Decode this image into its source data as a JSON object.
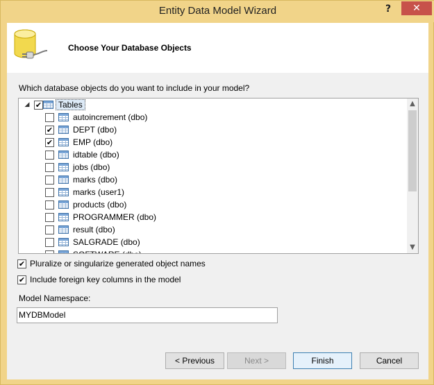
{
  "window": {
    "title": "Entity Data Model Wizard",
    "help_label": "?",
    "close_label": "✕"
  },
  "header": {
    "title": "Choose Your Database Objects"
  },
  "prompt": "Which database objects do you want to include in your model?",
  "tree": {
    "root": {
      "label": "Tables",
      "checked": true,
      "expanded": true
    },
    "items": [
      {
        "label": "autoincrement (dbo)",
        "checked": false
      },
      {
        "label": "DEPT (dbo)",
        "checked": true
      },
      {
        "label": "EMP (dbo)",
        "checked": true
      },
      {
        "label": "idtable (dbo)",
        "checked": false
      },
      {
        "label": "jobs (dbo)",
        "checked": false
      },
      {
        "label": "marks (dbo)",
        "checked": false
      },
      {
        "label": "marks (user1)",
        "checked": false
      },
      {
        "label": "products (dbo)",
        "checked": false
      },
      {
        "label": "PROGRAMMER (dbo)",
        "checked": false
      },
      {
        "label": "result (dbo)",
        "checked": false
      },
      {
        "label": "SALGRADE (dbo)",
        "checked": false
      },
      {
        "label": "SOFTWARE (dbo)",
        "checked": false
      }
    ]
  },
  "options": {
    "pluralize": {
      "label": "Pluralize or singularize generated object names",
      "checked": true
    },
    "foreign_keys": {
      "label": "Include foreign key columns in the model",
      "checked": true
    }
  },
  "namespace": {
    "label": "Model Namespace:",
    "value": "MYDBModel"
  },
  "buttons": {
    "previous": "< Previous",
    "next": "Next >",
    "finish": "Finish",
    "cancel": "Cancel"
  },
  "check_glyph": "✔"
}
